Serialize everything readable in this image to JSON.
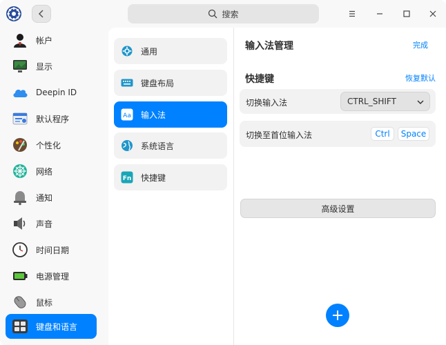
{
  "titlebar": {
    "search_placeholder": "搜索",
    "search_icon": "search-icon",
    "back_icon": "chevron-left-icon",
    "menu_icon": "menu-icon",
    "minimize_icon": "minimize-icon",
    "maximize_icon": "maximize-icon",
    "close_icon": "close-icon"
  },
  "sidebar": {
    "items": [
      {
        "label": "帐户",
        "icon": "account-icon"
      },
      {
        "label": "显示",
        "icon": "display-icon"
      },
      {
        "label": "Deepin ID",
        "icon": "cloud-icon"
      },
      {
        "label": "默认程序",
        "icon": "default-apps-icon"
      },
      {
        "label": "个性化",
        "icon": "personalization-icon"
      },
      {
        "label": "网络",
        "icon": "network-icon"
      },
      {
        "label": "通知",
        "icon": "bell-icon"
      },
      {
        "label": "声音",
        "icon": "speaker-icon"
      },
      {
        "label": "时间日期",
        "icon": "clock-icon"
      },
      {
        "label": "电源管理",
        "icon": "battery-icon"
      },
      {
        "label": "鼠标",
        "icon": "mouse-icon"
      },
      {
        "label": "键盘和语言",
        "icon": "keyboard-icon",
        "active": true
      }
    ]
  },
  "subnav": {
    "items": [
      {
        "label": "通用",
        "icon": "gear-icon"
      },
      {
        "label": "键盘布局",
        "icon": "keyboard-layout-icon"
      },
      {
        "label": "输入法",
        "icon": "input-method-icon",
        "active": true
      },
      {
        "label": "系统语言",
        "icon": "globe-icon"
      },
      {
        "label": "快捷键",
        "icon": "fn-key-icon"
      }
    ]
  },
  "main": {
    "im_manage_title": "输入法管理",
    "done_link": "完成",
    "shortcut_title": "快捷键",
    "restore_link": "恢复默认",
    "switch_im_label": "切换输入法",
    "switch_im_value": "CTRL_SHIFT",
    "switch_first_label": "切换至首位输入法",
    "key_ctrl": "Ctrl",
    "key_space": "Space",
    "advanced_button": "高级设置",
    "add_icon": "plus-icon"
  },
  "colors": {
    "accent": "#0081ff",
    "panel": "#ffffff",
    "row": "#f2f2f2",
    "background": "#f8f8f8"
  }
}
